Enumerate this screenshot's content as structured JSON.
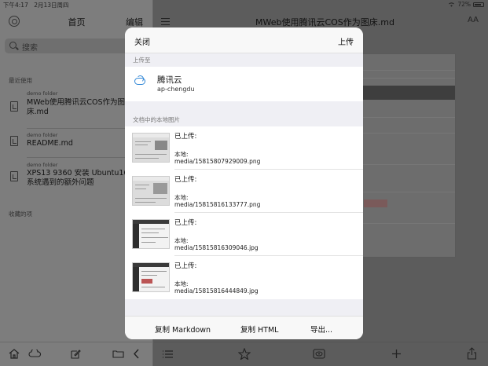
{
  "status_bar": {
    "time": "下午4:17",
    "date": "2月13日周四",
    "battery": "72%",
    "wifi_icon": "wifi-icon",
    "battery_icon": "battery-icon"
  },
  "sidebar": {
    "title": "首页",
    "edit_label": "编辑",
    "search_placeholder": "搜索",
    "recent_label": "最近使用",
    "favorites_label": "收藏的项",
    "documents": [
      {
        "folder": "demo folder",
        "name_line1": "MWeb使用腾讯云COS作为图",
        "name_line2": "床.md"
      },
      {
        "folder": "demo folder",
        "name_line1": "README.md",
        "name_line2": ""
      },
      {
        "folder": "demo folder",
        "name_line1": "XPS13 9360 安装 Ubuntu16.0",
        "name_line2": "系统遇到的额外问题"
      }
    ]
  },
  "editor": {
    "title": "MWeb使用腾讯云COS作为图床.md",
    "font_button": "AA"
  },
  "modal": {
    "close_label": "关闭",
    "upload_label": "上传",
    "upload_to_label": "上传至",
    "cloud": {
      "name": "腾讯云",
      "region": "ap-chengdu"
    },
    "local_images_label": "文档中的本地图片",
    "images": [
      {
        "status": "已上传:",
        "local_label": "本地:",
        "path": "media/15815807929009.png"
      },
      {
        "status": "已上传:",
        "local_label": "本地:",
        "path": "media/15815816133777.png"
      },
      {
        "status": "已上传:",
        "local_label": "本地:",
        "path": "media/15815816309046.jpg"
      },
      {
        "status": "已上传:",
        "local_label": "本地:",
        "path": "media/15815816444849.jpg"
      }
    ],
    "footer": {
      "copy_markdown": "复制 Markdown",
      "copy_html": "复制 HTML",
      "export": "导出..."
    }
  },
  "colors": {
    "accent": "#2f86d6",
    "modal_bg": "#ffffff",
    "dim_overlay": "#5c5c5c"
  }
}
